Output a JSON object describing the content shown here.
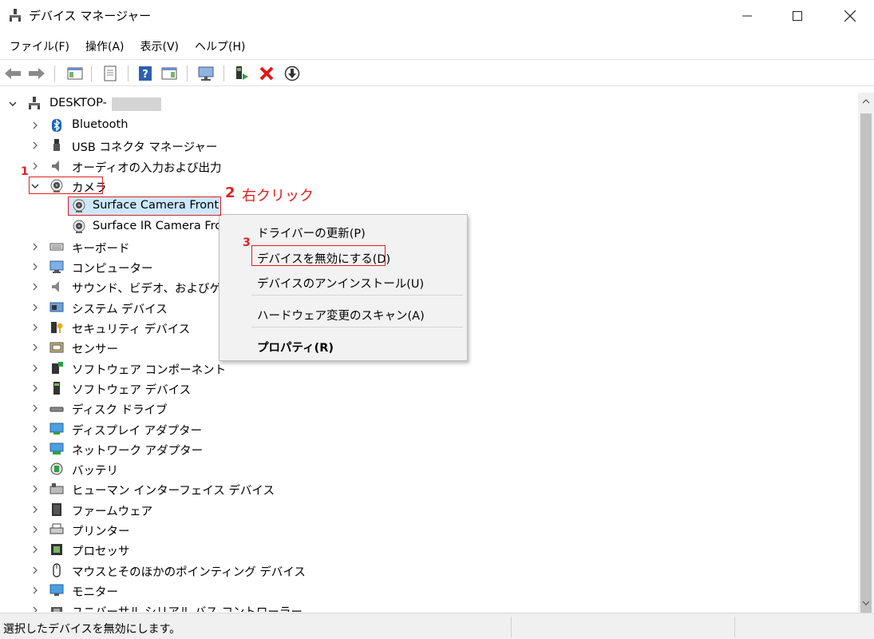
{
  "window": {
    "title": "デバイス マネージャー",
    "accent": "#e02020"
  },
  "menu": [
    {
      "label": "ファイル(F)"
    },
    {
      "label": "操作(A)"
    },
    {
      "label": "表示(V)"
    },
    {
      "label": "ヘルプ(H)"
    }
  ],
  "toolbar": {
    "icons": [
      "back-arrow-icon",
      "forward-arrow-icon",
      "show-hide-console-tree-icon",
      "properties-icon",
      "help-icon",
      "action-pane-icon",
      "scan-hardware-icon",
      "update-driver-icon",
      "uninstall-icon",
      "disable-device-icon"
    ]
  },
  "tree": {
    "root": "DESKTOP-",
    "items": [
      {
        "label": "Bluetooth",
        "icon": "bluetooth-icon"
      },
      {
        "label": "USB コネクタ マネージャー",
        "icon": "usb-connector-icon"
      },
      {
        "label": "オーディオの入力および出力",
        "icon": "audio-icon"
      },
      {
        "label": "カメラ",
        "icon": "camera-icon",
        "expanded": true
      },
      {
        "label": "Surface Camera Front",
        "icon": "camera-icon",
        "child": true,
        "selected": true
      },
      {
        "label": "Surface IR Camera Fro",
        "icon": "camera-icon",
        "child": true
      },
      {
        "label": "キーボード",
        "icon": "keyboard-icon"
      },
      {
        "label": "コンピューター",
        "icon": "computer-icon"
      },
      {
        "label": "サウンド、ビデオ、およびゲーム",
        "icon": "sound-icon"
      },
      {
        "label": "システム デバイス",
        "icon": "system-device-icon"
      },
      {
        "label": "セキュリティ デバイス",
        "icon": "security-device-icon"
      },
      {
        "label": "センサー",
        "icon": "sensor-icon"
      },
      {
        "label": "ソフトウェア コンポーネント",
        "icon": "software-component-icon"
      },
      {
        "label": "ソフトウェア デバイス",
        "icon": "software-device-icon"
      },
      {
        "label": "ディスク ドライブ",
        "icon": "disk-drive-icon"
      },
      {
        "label": "ディスプレイ アダプター",
        "icon": "display-adapter-icon"
      },
      {
        "label": "ネットワーク アダプター",
        "icon": "network-adapter-icon"
      },
      {
        "label": "バッテリ",
        "icon": "battery-icon"
      },
      {
        "label": "ヒューマン インターフェイス デバイス",
        "icon": "hid-icon"
      },
      {
        "label": "ファームウェア",
        "icon": "firmware-icon"
      },
      {
        "label": "プリンター",
        "icon": "printer-icon"
      },
      {
        "label": "プロセッサ",
        "icon": "processor-icon"
      },
      {
        "label": "マウスとそのほかのポインティング デバイス",
        "icon": "mouse-icon"
      },
      {
        "label": "モニター",
        "icon": "monitor-icon"
      },
      {
        "label": "ユニバーサル シリアル バス コントローラー",
        "icon": "usb-controller-icon"
      }
    ]
  },
  "context_menu": {
    "items": [
      {
        "label": "ドライバーの更新(P)"
      },
      {
        "label": "デバイスを無効にする(D)"
      },
      {
        "label": "デバイスのアンインストール(U)"
      },
      {
        "label": "ハードウェア変更のスキャン(A)"
      },
      {
        "label": "プロパティ(R)"
      }
    ]
  },
  "annotations": {
    "step1": "1",
    "step2": "2",
    "step2_text": "右クリック",
    "step3": "3"
  },
  "status": {
    "text": "選択したデバイスを無効にします。"
  }
}
